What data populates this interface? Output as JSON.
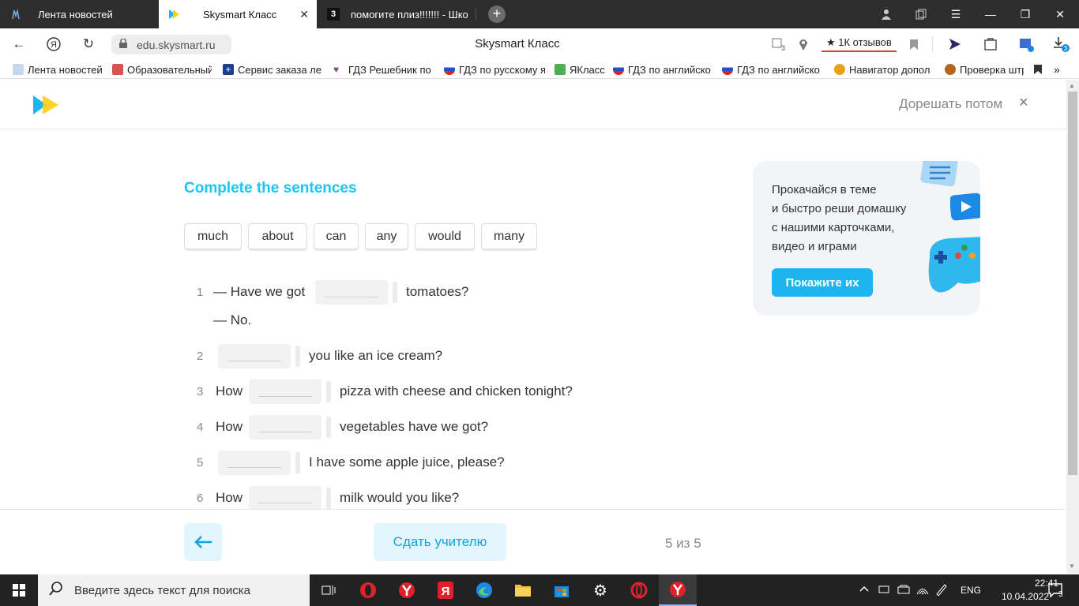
{
  "tabs": [
    {
      "title": "Лента новостей",
      "active": false
    },
    {
      "title": "Skysmart Класс",
      "active": true
    },
    {
      "title": "помогите плиз!!!!!!! - Шко",
      "active": false
    }
  ],
  "address": {
    "url": "edu.skysmart.ru",
    "page_title": "Skysmart Класс",
    "reviews": "★ 1К отзывов",
    "tabs_count": "3",
    "downloads_count": "3"
  },
  "bookmarks": [
    {
      "label": "Лента новостей",
      "color": "#3a7be0"
    },
    {
      "label": "Образовательный",
      "color": "#d9534f"
    },
    {
      "label": "Сервис заказа ле",
      "color": "#1a3f8f"
    },
    {
      "label": "ГДЗ Решебник по",
      "color": "#8a4a8a"
    },
    {
      "label": "ГДЗ по русскому я",
      "color": "#d22"
    },
    {
      "label": "ЯКласс",
      "color": "#4caf50"
    },
    {
      "label": "ГДЗ по английско",
      "color": "#d22"
    },
    {
      "label": "ГДЗ по английско",
      "color": "#d22"
    },
    {
      "label": "Навигатор допол",
      "color": "#e8a21a"
    },
    {
      "label": "Проверка штр",
      "color": "#b5651d"
    }
  ],
  "app": {
    "later_label": "Дорешать потом",
    "close_label": "×"
  },
  "exercise": {
    "heading": "Complete the sentences",
    "words": [
      "much",
      "about",
      "can",
      "any",
      "would",
      "many"
    ],
    "sentences": [
      {
        "num": "1",
        "before": "— Have we got",
        "after": "tomatoes?",
        "extra": "— No."
      },
      {
        "num": "2",
        "before": "",
        "after": "you like an ice cream?"
      },
      {
        "num": "3",
        "before": "How",
        "after": "pizza with cheese and chicken tonight?"
      },
      {
        "num": "4",
        "before": "How",
        "after": "vegetables have we got?"
      },
      {
        "num": "5",
        "before": "",
        "after": "I have some apple juice, please?"
      },
      {
        "num": "6",
        "before": "How",
        "after": "milk would you like?"
      }
    ]
  },
  "promo": {
    "lines": [
      "Прокачайся в теме",
      "и быстро реши домашку",
      "с нашими карточками,",
      "видео и играми"
    ],
    "button": "Покажите их"
  },
  "footer": {
    "submit": "Сдать учителю",
    "progress": "5 из 5"
  },
  "taskbar": {
    "search_placeholder": "Введите здесь текст для поиска",
    "lang": "ENG",
    "time": "22:41",
    "date": "10.04.2022",
    "notifications": "3"
  }
}
